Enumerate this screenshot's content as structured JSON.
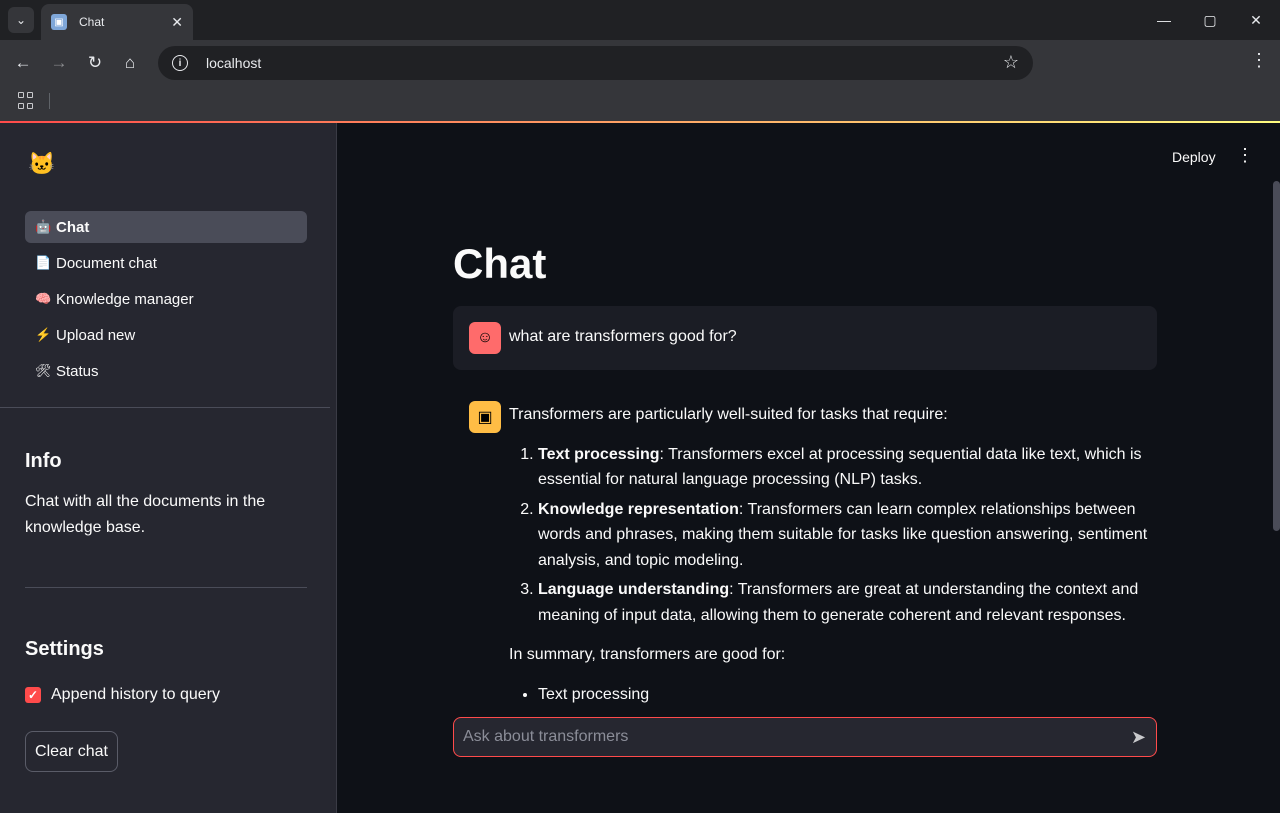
{
  "browser": {
    "tab_title": "Chat",
    "url": "localhost"
  },
  "sidebar": {
    "nav": [
      {
        "emoji": "🤖",
        "label": "Chat",
        "active": true
      },
      {
        "emoji": "📄",
        "label": "Document chat",
        "active": false
      },
      {
        "emoji": "🧠",
        "label": "Knowledge manager",
        "active": false
      },
      {
        "emoji": "⚡",
        "label": "Upload new",
        "active": false
      },
      {
        "emoji": "🛠",
        "label": "Status",
        "active": false
      }
    ],
    "info_heading": "Info",
    "info_text": "Chat with all the documents in the knowledge base.",
    "settings_heading": "Settings",
    "append_history_label": "Append history to query",
    "append_history_checked": true,
    "clear_chat_label": "Clear chat"
  },
  "main": {
    "deploy_label": "Deploy",
    "title": "Chat",
    "user_message": "what are transformers good for?",
    "bot_intro": "Transformers are particularly well-suited for tasks that require:",
    "bot_points": [
      {
        "term": "Text processing",
        "text": ": Transformers excel at processing sequential data like text, which is essential for natural language processing (NLP) tasks."
      },
      {
        "term": "Knowledge representation",
        "text": ": Transformers can learn complex relationships between words and phrases, making them suitable for tasks like question answering, sentiment analysis, and topic modeling."
      },
      {
        "term": "Language understanding",
        "text": ": Transformers are great at understanding the context and meaning of input data, allowing them to generate coherent and relevant responses."
      }
    ],
    "bot_summary": "In summary, transformers are good for:",
    "bot_bullets": [
      "Text processing"
    ],
    "input_placeholder": "Ask about transformers"
  },
  "colors": {
    "accent": "#ff4b4b",
    "sidebar_bg": "#262730",
    "main_bg": "#0e1117",
    "user_avatar": "#ff6b6b",
    "bot_avatar": "#ffbd45"
  }
}
